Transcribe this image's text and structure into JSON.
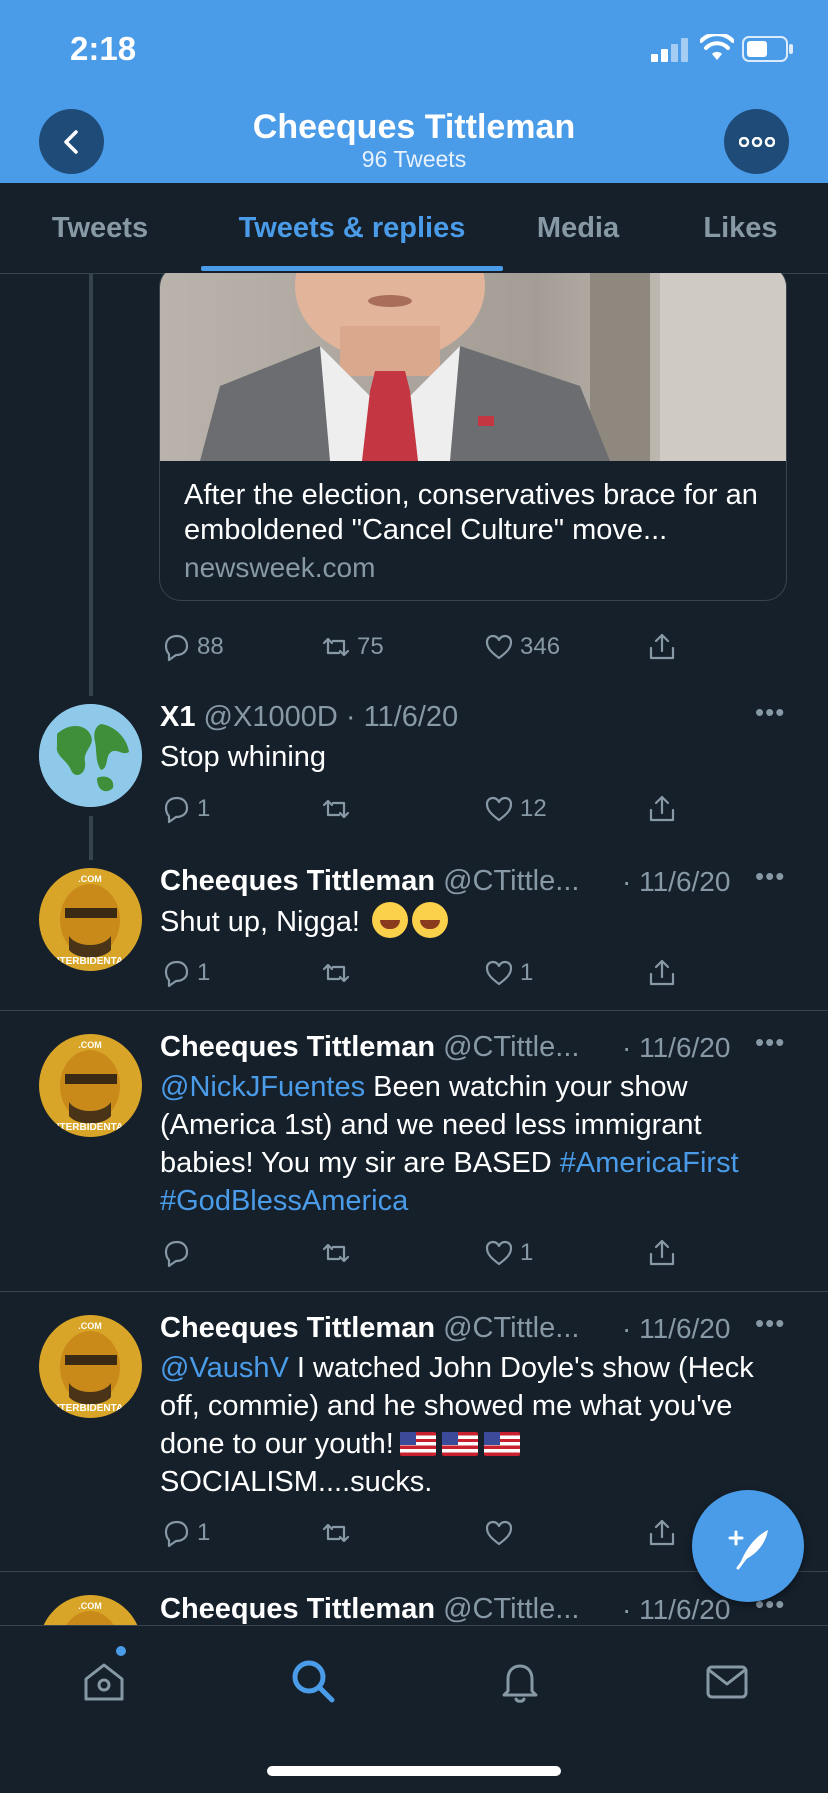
{
  "status_bar": {
    "time": "2:18"
  },
  "header": {
    "name": "Cheeques Tittleman",
    "tweet_count": "96 Tweets",
    "back_icon": "chevron-left-icon",
    "more_icon": "ellipsis-icon"
  },
  "tabs": [
    {
      "label": "Tweets",
      "active": false
    },
    {
      "label": "Tweets & replies",
      "active": true
    },
    {
      "label": "Media",
      "active": false
    },
    {
      "label": "Likes",
      "active": false
    }
  ],
  "card": {
    "title": "After the election, conservatives brace for an emboldened \"Cancel Culture\" move...",
    "domain": "newsweek.com",
    "counts": {
      "replies": "88",
      "retweets": "75",
      "likes": "346"
    }
  },
  "tweets": [
    {
      "name": "X1",
      "handle": "@X1000D",
      "date": "· 11/6/20",
      "text": "Stop whining",
      "counts": {
        "replies": "1",
        "retweets": "",
        "likes": "12"
      }
    },
    {
      "name": "Cheeques Tittleman",
      "handle": "@CTittle...",
      "date": "· 11/6/20",
      "text": "Shut up, Nigga!",
      "counts": {
        "replies": "1",
        "retweets": "",
        "likes": "1"
      }
    },
    {
      "name": "Cheeques Tittleman",
      "handle": "@CTittle...",
      "date": "· 11/6/20",
      "mention": "@NickJFuentes",
      "text": " Been watchin your show (America 1st) and we need less immigrant babies! You my sir are BASED ",
      "hashtag1": "#AmericaFirst",
      "hashtag2": "#GodBlessAmerica",
      "counts": {
        "replies": "",
        "retweets": "",
        "likes": "1"
      }
    },
    {
      "name": "Cheeques Tittleman",
      "handle": "@CTittle...",
      "date": "· 11/6/20",
      "mention": "@VaushV",
      "text": " I watched John Doyle's show (Heck off, commie) and he showed me what you've done to our youth!",
      "text2": "SOCIALISM....sucks.",
      "counts": {
        "replies": "1",
        "retweets": "",
        "likes": ""
      }
    },
    {
      "name": "Cheeques Tittleman",
      "handle": "@CTittle...",
      "date": "· 11/6/20"
    }
  ],
  "avatar_label": "ITERBIDENTA",
  "avatar_watermark": ".COM",
  "bottom_nav": [
    "home-icon",
    "search-icon",
    "bell-icon",
    "mail-icon"
  ],
  "colors": {
    "accent": "#4a9be8",
    "background": "#15202b",
    "border": "#38444d",
    "muted": "#8899a6"
  }
}
